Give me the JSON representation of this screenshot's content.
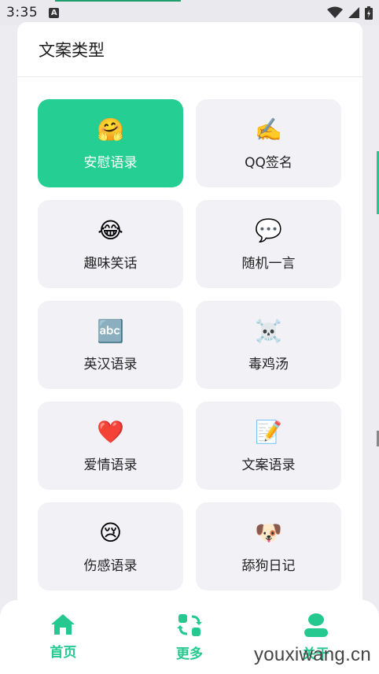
{
  "status_bar": {
    "time": "3:35"
  },
  "sheet": {
    "title": "文案类型",
    "items": [
      {
        "emoji": "🤗",
        "label": "安慰语录",
        "active": true
      },
      {
        "emoji": "✍️",
        "label": "QQ签名",
        "active": false
      },
      {
        "emoji": "😂",
        "label": "趣味笑话",
        "active": false
      },
      {
        "emoji": "💬",
        "label": "随机一言",
        "active": false
      },
      {
        "emoji": "🔤",
        "label": "英汉语录",
        "active": false
      },
      {
        "emoji": "☠️",
        "label": "毒鸡汤",
        "active": false
      },
      {
        "emoji": "❤️",
        "label": "爱情语录",
        "active": false
      },
      {
        "emoji": "📝",
        "label": "文案语录",
        "active": false
      },
      {
        "emoji": "😢",
        "label": "伤感语录",
        "active": false
      },
      {
        "emoji": "🐶",
        "label": "舔狗日记",
        "active": false
      }
    ]
  },
  "bottom_nav": {
    "items": [
      {
        "label": "首页",
        "icon": "home-icon"
      },
      {
        "label": "更多",
        "icon": "swap-icon"
      },
      {
        "label": "关于",
        "icon": "user-icon"
      }
    ]
  },
  "watermark": "youxiwang.cn",
  "colors": {
    "accent": "#25cf94",
    "card_bg": "#f2f2f6",
    "nav_accent": "#25c98f"
  }
}
